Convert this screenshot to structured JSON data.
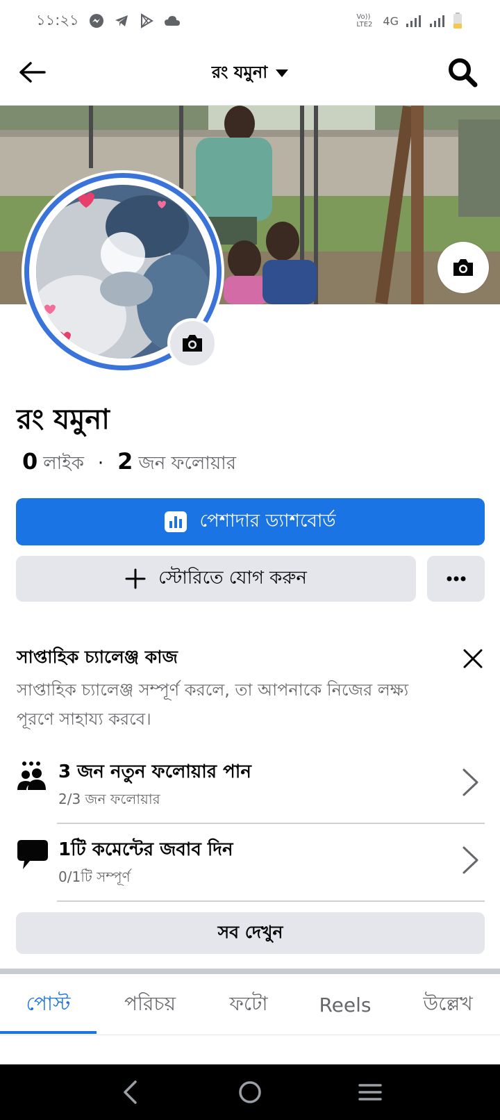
{
  "status_bar": {
    "time": "১১:২১",
    "network": "4G",
    "lte_label": "Vo)) LTE2"
  },
  "header": {
    "title": "রং যমুনা"
  },
  "profile": {
    "name": "রং যমুনা",
    "likes_count": "0",
    "likes_label": "লাইক",
    "followers_count": "2",
    "followers_label": "জন ফলোয়ার"
  },
  "actions": {
    "dashboard_label": "পেশাদার ড্যাশবোর্ড",
    "add_story_label": "স্টোরিতে যোগ করুন",
    "more_label": "···"
  },
  "challenge": {
    "title": "সাপ্তাহিক চ্যালেঞ্জ কাজ",
    "description": "সাপ্তাহিক চ্যালেঞ্জ সম্পূর্ণ করলে, তা আপনাকে নিজের লক্ষ্য পূরণে সাহায্য করবে।",
    "tasks": [
      {
        "title": "3 জন নতুন ফলোয়ার পান",
        "progress": "2/3 জন ফলোয়ার",
        "icon": "people-icon"
      },
      {
        "title": "1টি কমেন্টের জবাব দিন",
        "progress": "0/1টি সম্পূর্ণ",
        "icon": "comment-icon"
      }
    ],
    "see_all_label": "সব দেখুন"
  },
  "tabs": [
    {
      "label": "পোস্ট",
      "active": true
    },
    {
      "label": "পরিচয়",
      "active": false
    },
    {
      "label": "ফটো",
      "active": false
    },
    {
      "label": "Reels",
      "active": false
    },
    {
      "label": "উল্লেখ",
      "active": false
    }
  ],
  "colors": {
    "accent": "#1b74e4",
    "avatar_ring": "#3a73d9",
    "button_gray": "#e4e6eb",
    "secondary_text": "#65676b"
  }
}
